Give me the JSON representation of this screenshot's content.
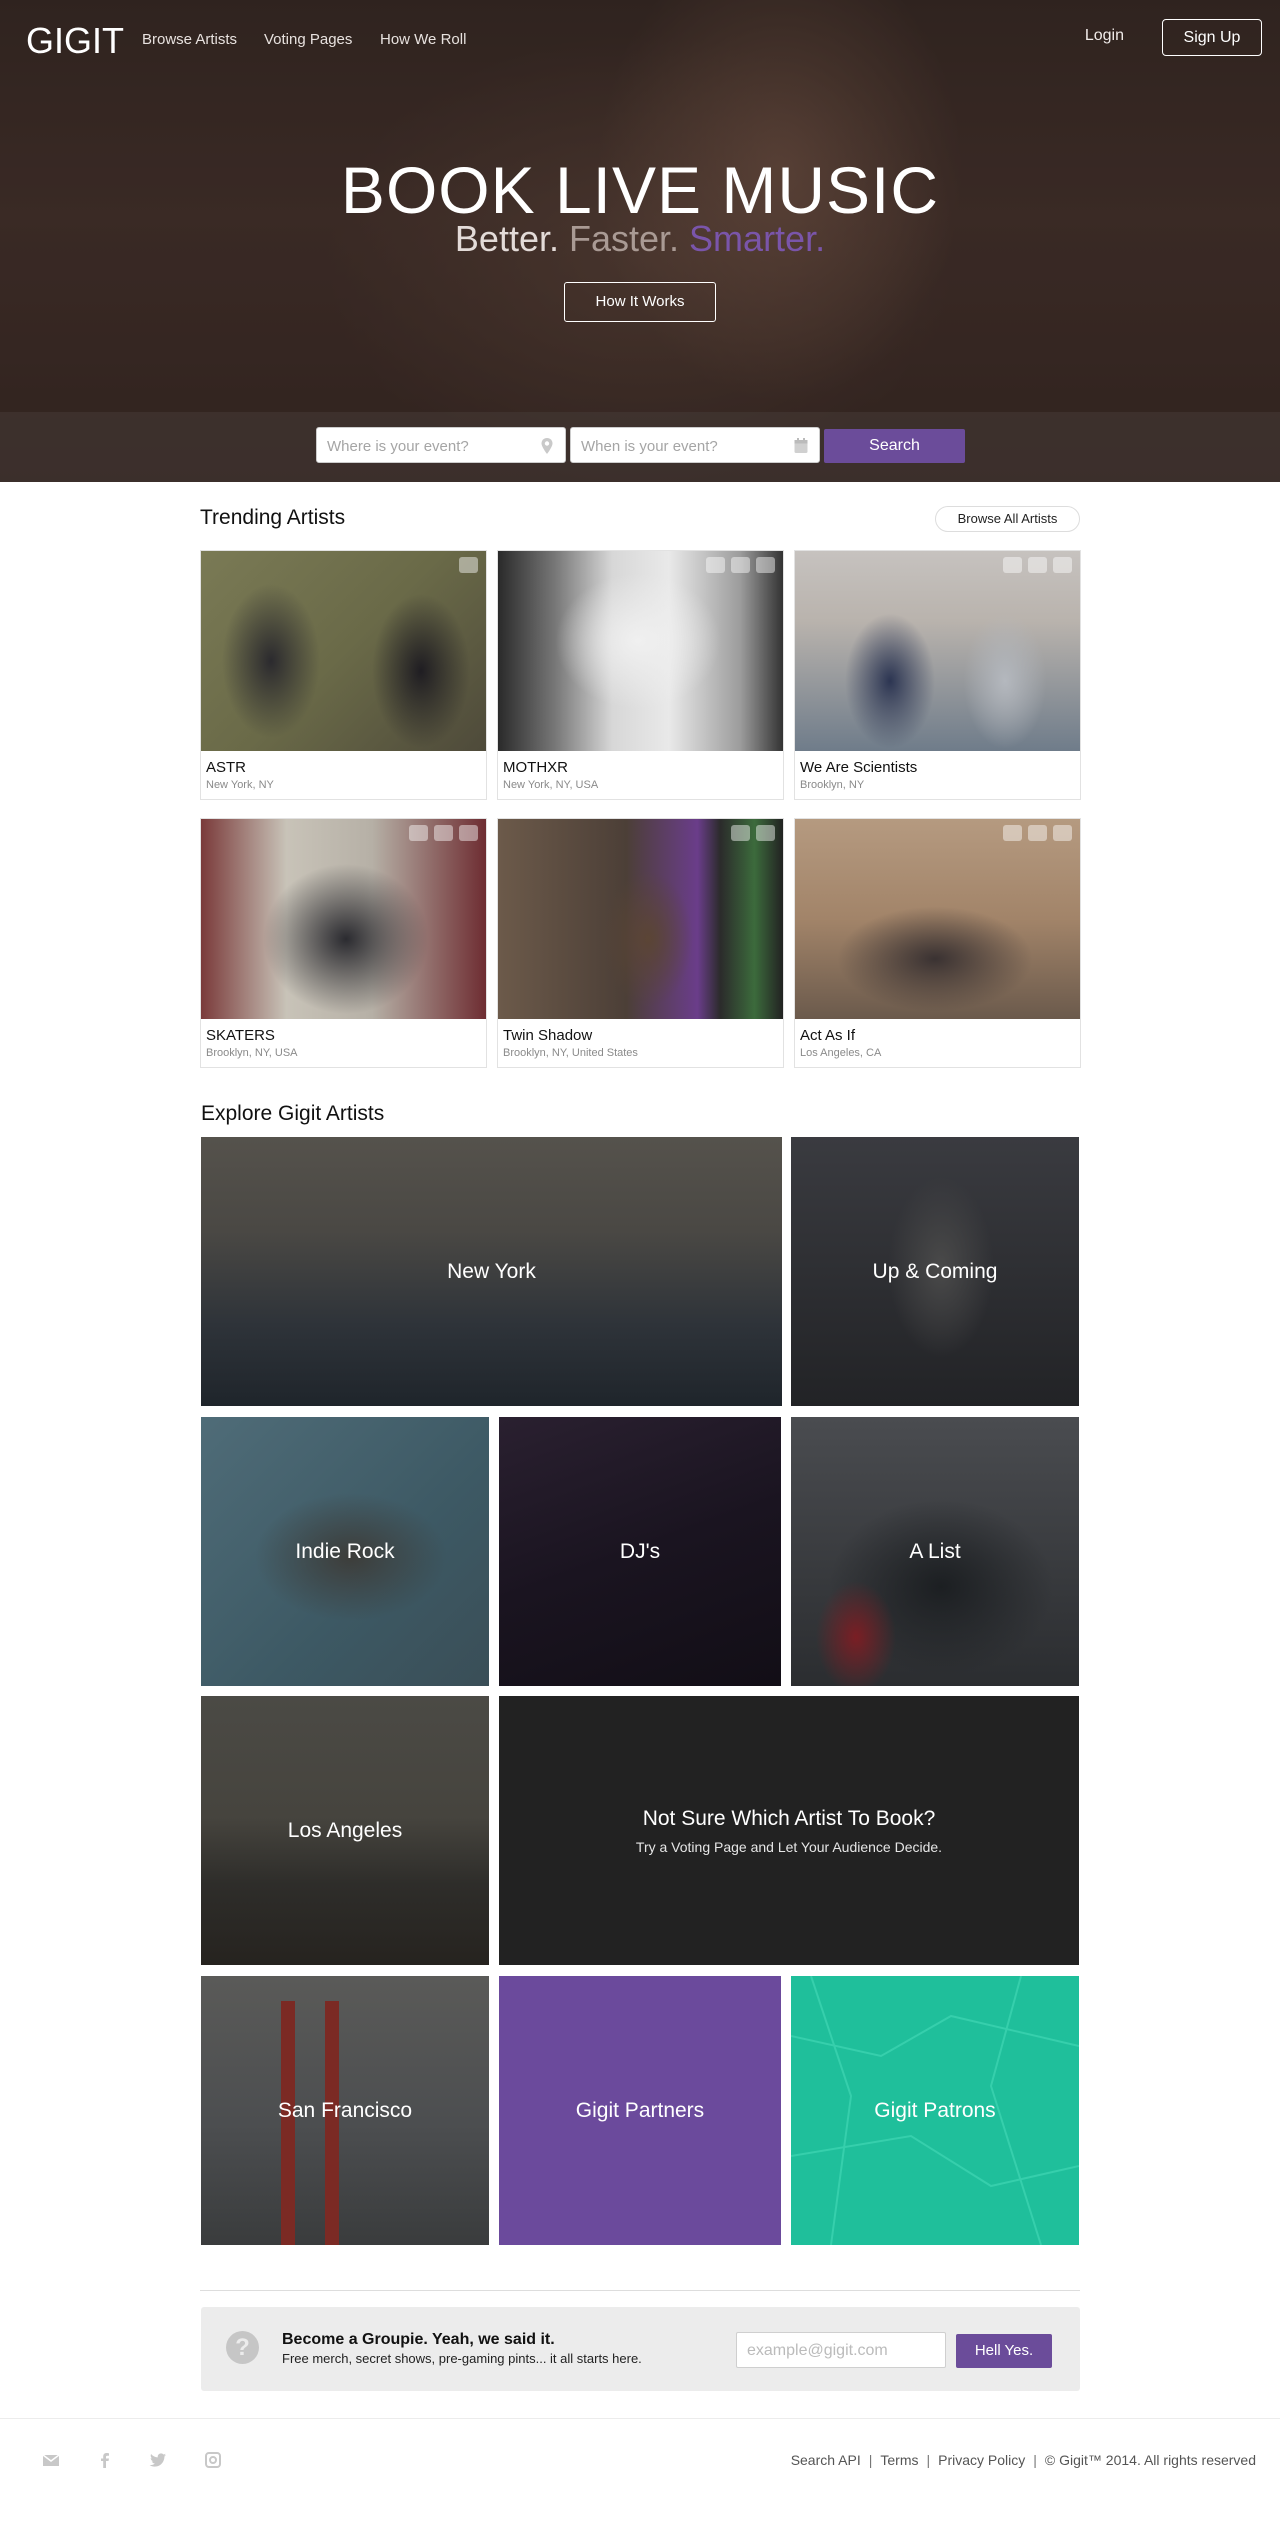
{
  "nav": {
    "logo": "GIGIT",
    "links": [
      "Browse Artists",
      "Voting Pages",
      "How We Roll"
    ],
    "login": "Login",
    "signup": "Sign Up"
  },
  "hero": {
    "headline": "BOOK LIVE MUSIC",
    "tagline": [
      "Better.",
      "Faster.",
      "Smarter."
    ],
    "cta": "How It Works"
  },
  "search": {
    "where_placeholder": "Where is your event?",
    "when_placeholder": "When is your event?",
    "button": "Search",
    "where_icon": "map-pin-icon",
    "when_icon": "calendar-icon"
  },
  "trending": {
    "title": "Trending Artists",
    "browse_all": "Browse All Artists",
    "artists": [
      {
        "name": "ASTR",
        "location": "New York, NY",
        "icons": [
          "camera-icon"
        ]
      },
      {
        "name": "MOTHXR",
        "location": "New York, NY, USA",
        "icons": [
          "music-icon",
          "camera-icon",
          "video-icon"
        ]
      },
      {
        "name": "We Are Scientists",
        "location": "Brooklyn, NY",
        "icons": [
          "music-icon",
          "camera-icon",
          "video-icon"
        ]
      },
      {
        "name": "SKATERS",
        "location": "Brooklyn, NY, USA",
        "icons": [
          "music-icon",
          "camera-icon",
          "video-icon"
        ]
      },
      {
        "name": "Twin Shadow",
        "location": "Brooklyn, NY, United States",
        "icons": [
          "camera-icon",
          "video-icon"
        ]
      },
      {
        "name": "Act As If",
        "location": "Los Angeles, CA",
        "icons": [
          "music-icon",
          "camera-icon",
          "video-icon"
        ]
      }
    ]
  },
  "explore": {
    "title": "Explore Gigit Artists",
    "tiles": {
      "new_york": "New York",
      "up_coming": "Up & Coming",
      "indie_rock": "Indie Rock",
      "djs": "DJ's",
      "a_list": "A List",
      "los_angeles": "Los Angeles",
      "voting_title": "Not Sure Which Artist To Book?",
      "voting_sub": "Try a Voting Page and Let Your Audience Decide.",
      "san_francisco": "San Francisco",
      "partners": "Gigit Partners",
      "patrons": "Gigit Patrons"
    }
  },
  "groupie": {
    "title": "Become a Groupie. Yeah, we said it.",
    "subtitle": "Free merch, secret shows, pre-gaming pints... it all starts here.",
    "placeholder": "example@gigit.com",
    "button": "Hell Yes."
  },
  "footer": {
    "social": [
      "email-icon",
      "facebook-icon",
      "twitter-icon",
      "instagram-icon"
    ],
    "links": [
      "Search API",
      "Terms",
      "Privacy Policy"
    ],
    "copyright": "© Gigit™ 2014. All rights reserved"
  },
  "colors": {
    "accent_purple": "#6b4c9a",
    "patrons_teal": "#1fbf9b",
    "voting_dark": "#222222"
  }
}
